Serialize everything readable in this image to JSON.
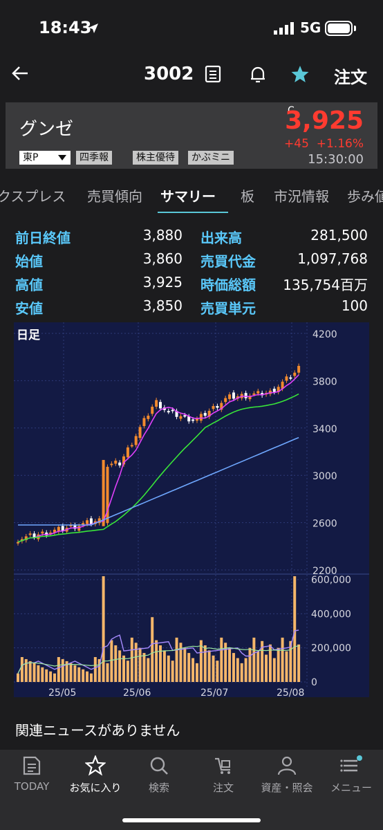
{
  "status": {
    "time": "18:43",
    "network": "5G"
  },
  "nav": {
    "code": "3002",
    "order_label": "注文"
  },
  "quote": {
    "name": "グンゼ",
    "market": "東P",
    "flag": "C",
    "price": "3,925",
    "change": "+45",
    "change_pct": "+1.16%",
    "time": "15:30:00",
    "tags": [
      "四季報",
      "株主優待",
      "かぶミニ"
    ]
  },
  "tabs": [
    "クスプレス",
    "売買傾向",
    "サマリー",
    "板",
    "市況情報",
    "歩み値"
  ],
  "summary": [
    {
      "l1": "前日終値",
      "v1": "3,880",
      "l2": "出来高",
      "v2": "281,500"
    },
    {
      "l1": "始値",
      "v1": "3,860",
      "l2": "売買代金",
      "v2": "1,097,768"
    },
    {
      "l1": "高値",
      "v1": "3,925",
      "l2": "時価総額",
      "v2": "135,754百万"
    },
    {
      "l1": "安値",
      "v1": "3,850",
      "l2": "売買単元",
      "v2": "100"
    }
  ],
  "chart_data": {
    "type": "candlestick",
    "title": "日足",
    "price_ticks": [
      "4200",
      "3800",
      "3400",
      "3000",
      "2600",
      "2200"
    ],
    "price_ylim": [
      2200,
      4200
    ],
    "volume_ticks": [
      "600,000",
      "400,000",
      "200,000",
      "0"
    ],
    "volume_ylim": [
      0,
      600000
    ],
    "x_labels": [
      "25/05",
      "25/06",
      "25/07",
      "25/08"
    ],
    "colors": {
      "up": "#f28a2e",
      "down": "#ffffff",
      "ma_short": "#e040fb",
      "ma_mid": "#39e639",
      "ma_long": "#6fa8ff",
      "volume": "#f4b66a"
    }
  },
  "news": "関連ニュースがありません",
  "tabbar": [
    "TODAY",
    "お気に入り",
    "検索",
    "注文",
    "資産・照会",
    "メニュー"
  ]
}
